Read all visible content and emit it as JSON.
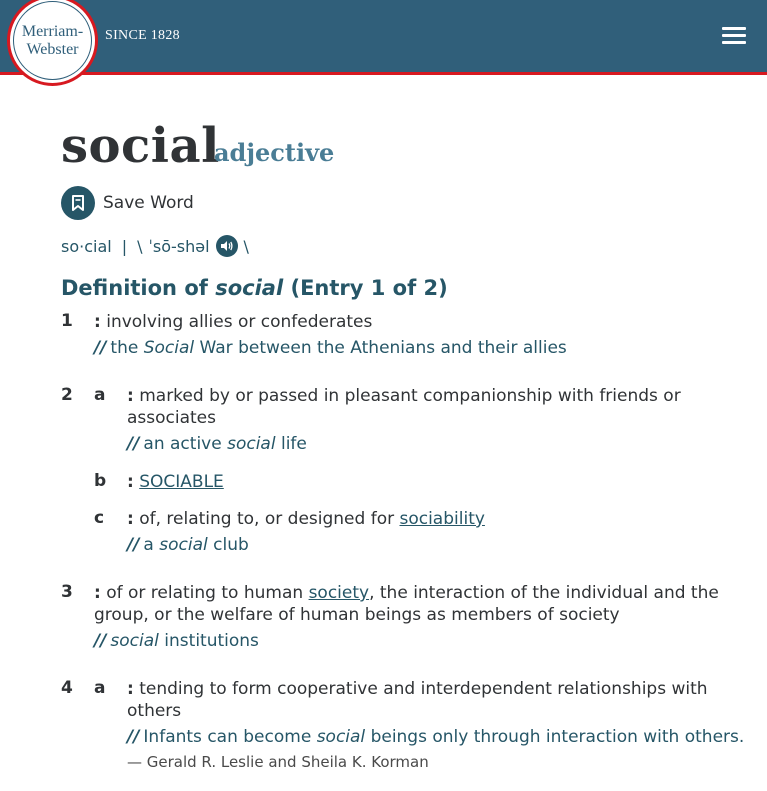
{
  "header": {
    "logo_line1": "Merriam-",
    "logo_line2": "Webster",
    "since": "SINCE 1828",
    "menu_icon": "hamburger-menu-icon"
  },
  "entry": {
    "headword": "social",
    "part_of_speech": "adjective",
    "save_label": "Save Word",
    "syllables": "so·cial",
    "pron_sep": "|",
    "pron_open": "\\",
    "pronunciation": "ˈsō-shəl",
    "pron_close": "\\",
    "def_title_prefix": "Definition of",
    "def_title_word": "social",
    "def_title_suffix": "(Entry 1 of 2)"
  },
  "senses": {
    "s1": {
      "num": "1",
      "colon": ":",
      "text": "involving allies or confederates",
      "ex_mark": "//",
      "ex_pre": "the",
      "ex_word": "Social",
      "ex_post": "War between the Athenians and their allies"
    },
    "s2a": {
      "num": "2",
      "letter": "a",
      "colon": ":",
      "text": "marked by or passed in pleasant companionship with friends or associates",
      "ex_mark": "//",
      "ex_pre": "an active",
      "ex_word": "social",
      "ex_post": "life"
    },
    "s2b": {
      "letter": "b",
      "colon": ":",
      "link": "SOCIABLE"
    },
    "s2c": {
      "letter": "c",
      "colon": ":",
      "text": "of, relating to, or designed for",
      "link": "sociability",
      "ex_mark": "//",
      "ex_pre": "a",
      "ex_word": "social",
      "ex_post": "club"
    },
    "s3": {
      "num": "3",
      "colon": ":",
      "text_pre": "of or relating to human",
      "link": "society",
      "text_post": ", the interaction of the individual and the group, or the welfare of human beings as members of society",
      "ex_mark": "//",
      "ex_word": "social",
      "ex_post": "institutions"
    },
    "s4a": {
      "num": "4",
      "letter": "a",
      "colon": ":",
      "text": "tending to form cooperative and interdependent relationships with others",
      "ex_mark": "//",
      "ex_pre": "Infants can become",
      "ex_word": "social",
      "ex_post": "beings only through interaction with others.",
      "attribution": "— Gerald R. Leslie and Sheila K. Korman"
    }
  },
  "colors": {
    "header_bg": "#305f7a",
    "accent_red": "#d71920",
    "link_teal": "#265667"
  }
}
